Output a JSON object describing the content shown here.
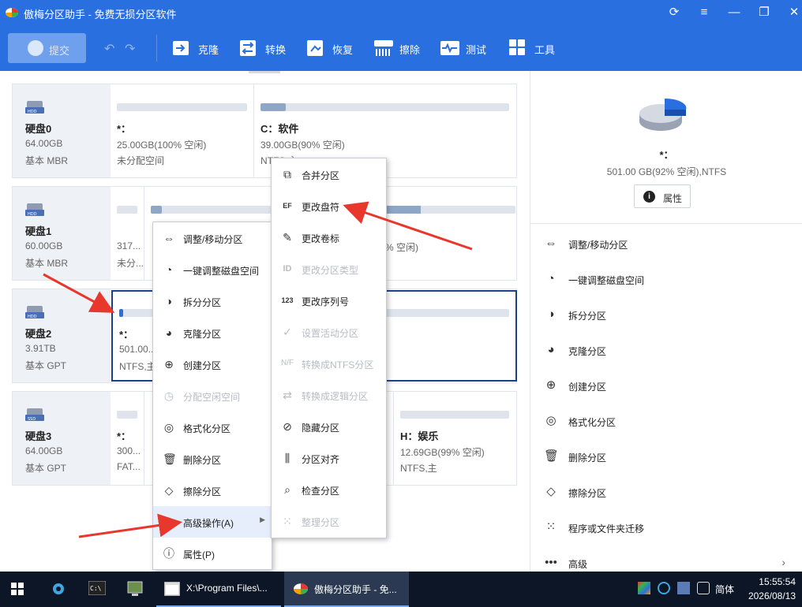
{
  "window": {
    "title": "傲梅分区助手 - 免费无损分区软件",
    "controls": [
      "refresh",
      "menu",
      "minimize",
      "restore",
      "close"
    ]
  },
  "toolbar": {
    "commit": "提交",
    "tools": [
      {
        "label": "克隆",
        "icon": "clone-icon"
      },
      {
        "label": "转换",
        "icon": "convert-icon"
      },
      {
        "label": "恢复",
        "icon": "recover-icon"
      },
      {
        "label": "擦除",
        "icon": "wipe-icon"
      },
      {
        "label": "测试",
        "icon": "test-icon"
      },
      {
        "label": "工具",
        "icon": "tools-icon"
      }
    ]
  },
  "disks": [
    {
      "name": "硬盘0",
      "size": "64.00GB",
      "type": "基本 MBR",
      "kind": "HDD",
      "partitions": [
        {
          "name": "*：",
          "line1": "25.00GB(100% 空闲)",
          "line2": "未分配空间",
          "fill": 0
        },
        {
          "name": "C：软件",
          "line1": "39.00GB(90% 空闲)",
          "line2": "NTFS,主",
          "fill": 0.1
        }
      ]
    },
    {
      "name": "硬盘1",
      "size": "60.00GB",
      "type": "基本 MBR",
      "kind": "HDD",
      "partitions": [
        {
          "name": "",
          "line1": "317...",
          "line2": "未分...",
          "fill": 0
        },
        {
          "name": "",
          "line1": "",
          "line2": "",
          "fill": 0.03
        },
        {
          "name": "",
          "line1": "% 空闲)",
          "line2": "",
          "fill": 0.08
        }
      ]
    },
    {
      "name": "硬盘2",
      "size": "3.91TB",
      "type": "基本 GPT",
      "kind": "HDD",
      "partitions": [
        {
          "name": "*：",
          "line1": "501.00...",
          "line2": "NTFS,主",
          "fill": 0.08
        }
      ]
    },
    {
      "name": "硬盘3",
      "size": "64.00GB",
      "type": "基本 GPT",
      "kind": "SSD",
      "partitions": [
        {
          "name": "*：",
          "line1": "300...",
          "line2": "FAT...",
          "fill": 0
        },
        {
          "name": "H：娱乐",
          "line1": "12.69GB(99% 空闲)",
          "line2": "NTFS,主",
          "fill": 0
        }
      ]
    }
  ],
  "context_menu": {
    "items": [
      {
        "label": "调整/移动分区",
        "icon": "resize-icon",
        "enabled": true
      },
      {
        "label": "一键调整磁盘空间",
        "icon": "pie-adjust-icon",
        "enabled": true
      },
      {
        "label": "拆分分区",
        "icon": "split-icon",
        "enabled": true
      },
      {
        "label": "克隆分区",
        "icon": "clone-partition-icon",
        "enabled": true
      },
      {
        "label": "创建分区",
        "icon": "create-icon",
        "enabled": true
      },
      {
        "label": "分配空闲空间",
        "icon": "allocate-icon",
        "enabled": false
      },
      {
        "label": "格式化分区",
        "icon": "format-icon",
        "enabled": true
      },
      {
        "label": "删除分区",
        "icon": "trash-icon",
        "enabled": true
      },
      {
        "label": "擦除分区",
        "icon": "eraser-icon",
        "enabled": true
      },
      {
        "label": "高级操作(A)",
        "icon": "more-icon",
        "enabled": true,
        "highlighted": true
      },
      {
        "label": "属性(P)",
        "icon": "info-icon",
        "enabled": true
      }
    ]
  },
  "submenu": {
    "items": [
      {
        "label": "合并分区",
        "icon": "merge-icon",
        "enabled": true
      },
      {
        "label": "更改盘符",
        "icon": "drive-letter-icon",
        "enabled": true
      },
      {
        "label": "更改卷标",
        "icon": "pencil-icon",
        "enabled": true
      },
      {
        "label": "更改分区类型",
        "icon": "id-icon",
        "enabled": false
      },
      {
        "label": "更改序列号",
        "icon": "serial-icon",
        "enabled": true
      },
      {
        "label": "设置活动分区",
        "icon": "active-icon",
        "enabled": false
      },
      {
        "label": "转换成NTFS分区",
        "icon": "ntfs-icon",
        "enabled": false
      },
      {
        "label": "转换成逻辑分区",
        "icon": "logical-icon",
        "enabled": false
      },
      {
        "label": "隐藏分区",
        "icon": "hide-icon",
        "enabled": true
      },
      {
        "label": "分区对齐",
        "icon": "align-icon",
        "enabled": true
      },
      {
        "label": "检查分区",
        "icon": "search-icon",
        "enabled": true
      },
      {
        "label": "整理分区",
        "icon": "defrag-icon",
        "enabled": false
      }
    ]
  },
  "right_panel": {
    "name": "*：",
    "info": "501.00 GB(92% 空闲),NTFS",
    "used_fraction": 0.08,
    "properties_button": "属性",
    "actions": [
      {
        "label": "调整/移动分区",
        "icon": "resize-icon"
      },
      {
        "label": "一键调整磁盘空间",
        "icon": "pie-adjust-icon"
      },
      {
        "label": "拆分分区",
        "icon": "split-icon"
      },
      {
        "label": "克隆分区",
        "icon": "clone-partition-icon"
      },
      {
        "label": "创建分区",
        "icon": "create-icon"
      },
      {
        "label": "格式化分区",
        "icon": "format-icon"
      },
      {
        "label": "删除分区",
        "icon": "trash-icon"
      },
      {
        "label": "擦除分区",
        "icon": "eraser-icon"
      },
      {
        "label": "程序或文件夹迁移",
        "icon": "migrate-icon"
      },
      {
        "label": "高级",
        "icon": "more-icon"
      }
    ]
  },
  "taskbar": {
    "apps": [
      {
        "label": "X:\\Program Files\\...",
        "icon": "explorer-icon"
      },
      {
        "label": "傲梅分区助手 - 免...",
        "icon": "aomei-icon"
      }
    ],
    "lang": "简体",
    "time": "15:55:54",
    "date": "2026/08/13"
  },
  "colors": {
    "titlebar": "#2a6fe0",
    "arrow": "#e8372c",
    "selection": "#1f3e8a"
  }
}
